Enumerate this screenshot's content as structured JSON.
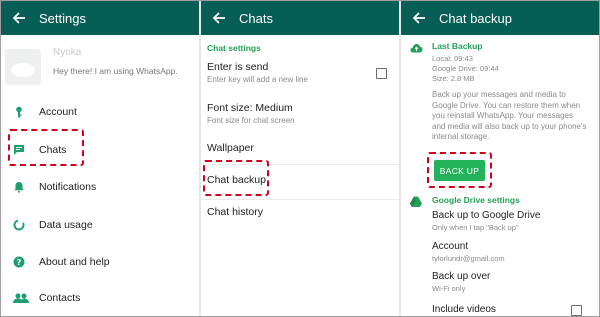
{
  "colors": {
    "appbar": "#075e54",
    "accent": "#23a055",
    "highlight": "#d0021b"
  },
  "settings": {
    "title": "Settings",
    "profile": {
      "name": "Nyoka",
      "status": "Hey there! I am using WhatsApp."
    },
    "items": [
      {
        "label": "Account",
        "icon": "key-icon"
      },
      {
        "label": "Chats",
        "icon": "chat-icon"
      },
      {
        "label": "Notifications",
        "icon": "bell-icon"
      },
      {
        "label": "Data usage",
        "icon": "data-usage-icon"
      },
      {
        "label": "About and help",
        "icon": "help-icon"
      },
      {
        "label": "Contacts",
        "icon": "contacts-icon"
      }
    ]
  },
  "chats": {
    "title": "Chats",
    "section": "Chat settings",
    "enter_send": {
      "label": "Enter is send",
      "sub": "Enter key will add a new line"
    },
    "font_size": {
      "label": "Font size: Medium",
      "sub": "Font size for chat screen"
    },
    "wallpaper": "Wallpaper",
    "chat_backup": "Chat backup",
    "chat_history": "Chat history"
  },
  "backup": {
    "title": "Chat backup",
    "last_backup_heading": "Last Backup",
    "local": "Local: 09:43",
    "google_drive": "Google Drive: 09:44",
    "size": "Size: 2.8 MB",
    "description": [
      "Back up your messages and media to",
      "Google Drive. You can restore them when",
      "you reinstall WhatsApp. Your messages",
      "and media will also back up to your phone's",
      "internal storage."
    ],
    "button": "BACK UP",
    "gdrive_heading": "Google Drive settings",
    "backup_to_drive": {
      "label": "Back up to Google Drive",
      "sub": "Only when I tap \"Back up\""
    },
    "account": {
      "label": "Account",
      "sub": "tylorlundr@gmail.com"
    },
    "backup_over": {
      "label": "Back up over",
      "sub": "Wi-Fi only"
    },
    "include_videos": "Include videos"
  }
}
